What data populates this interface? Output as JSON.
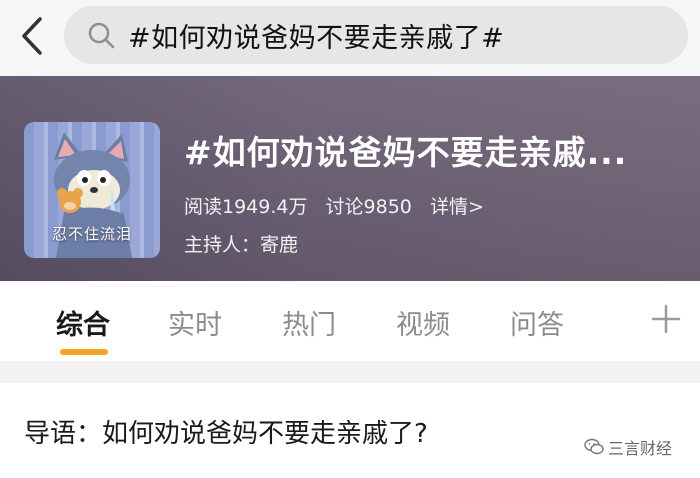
{
  "search": {
    "query": "#如何劝说爸妈不要走亲戚了#"
  },
  "topic": {
    "title": "#如何劝说爸妈不要走亲戚...",
    "avatar_caption": "忍不住流泪",
    "reads": "阅读1949.4万",
    "discussions": "讨论9850",
    "details_link": "详情>",
    "host": "主持人：寄鹿"
  },
  "tabs": [
    {
      "label": "综合",
      "active": true
    },
    {
      "label": "实时",
      "active": false
    },
    {
      "label": "热门",
      "active": false
    },
    {
      "label": "视频",
      "active": false
    },
    {
      "label": "问答",
      "active": false
    }
  ],
  "intro": {
    "text": "导语：如何劝说爸妈不要走亲戚了?"
  },
  "watermark": {
    "text": "三言财经"
  },
  "colors": {
    "accent": "#f5a623",
    "banner": "#6b5f74"
  },
  "icons": [
    "back-arrow-icon",
    "search-icon",
    "plus-icon",
    "wechat-icon"
  ]
}
